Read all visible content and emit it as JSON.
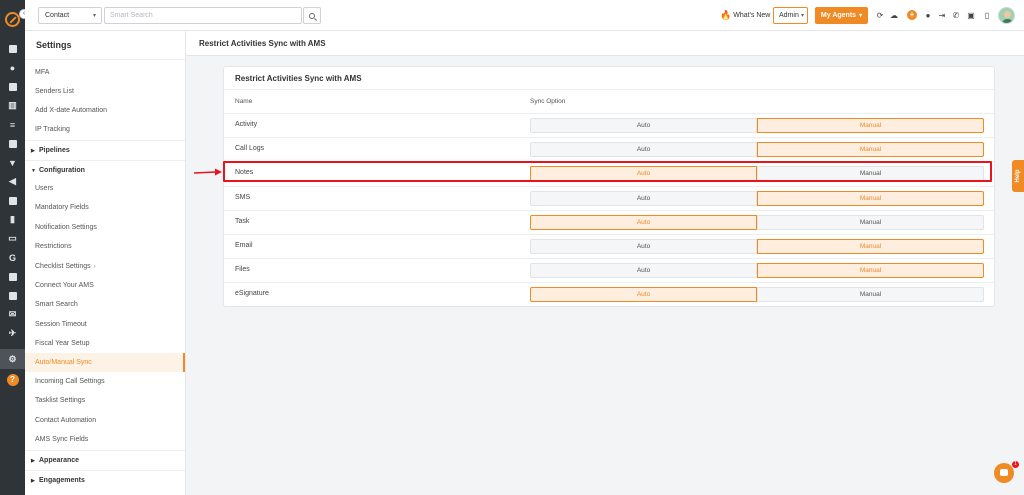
{
  "topbar": {
    "module_select": "Contact",
    "search_placeholder": "Smart Search",
    "whats_new": "What's New",
    "role_select": "Admin",
    "agents_button": "My Agents"
  },
  "settings": {
    "title": "Settings",
    "items": [
      {
        "label": "MFA",
        "type": "item"
      },
      {
        "label": "Senders List",
        "type": "item"
      },
      {
        "label": "Add X-date Automation",
        "type": "item"
      },
      {
        "label": "IP Tracking",
        "type": "item"
      },
      {
        "label": "Pipelines",
        "type": "section",
        "expanded": false
      },
      {
        "label": "Configuration",
        "type": "section",
        "expanded": true
      },
      {
        "label": "Users",
        "type": "item"
      },
      {
        "label": "Mandatory Fields",
        "type": "item"
      },
      {
        "label": "Notification Settings",
        "type": "item"
      },
      {
        "label": "Restrictions",
        "type": "item"
      },
      {
        "label": "Checklist Settings",
        "type": "item",
        "chevron": true
      },
      {
        "label": "Connect Your AMS",
        "type": "item"
      },
      {
        "label": "Smart Search",
        "type": "item"
      },
      {
        "label": "Session Timeout",
        "type": "item"
      },
      {
        "label": "Fiscal Year Setup",
        "type": "item"
      },
      {
        "label": "Auto/Manual Sync",
        "type": "item",
        "active": true
      },
      {
        "label": "Incoming Call Settings",
        "type": "item"
      },
      {
        "label": "Tasklist Settings",
        "type": "item"
      },
      {
        "label": "Contact Automation",
        "type": "item"
      },
      {
        "label": "AMS Sync Fields",
        "type": "item"
      },
      {
        "label": "Appearance",
        "type": "section",
        "expanded": false
      },
      {
        "label": "Engagements",
        "type": "section",
        "expanded": false
      }
    ]
  },
  "page": {
    "header_title": "Restrict Activities Sync with AMS",
    "card_title": "Restrict Activities Sync with AMS",
    "col_name": "Name",
    "col_sync": "Sync Option",
    "auto_label": "Auto",
    "manual_label": "Manual",
    "rows": [
      {
        "name": "Activity",
        "selected": "Manual"
      },
      {
        "name": "Call Logs",
        "selected": "Manual"
      },
      {
        "name": "Notes",
        "selected": "Auto"
      },
      {
        "name": "SMS",
        "selected": "Manual"
      },
      {
        "name": "Task",
        "selected": "Auto"
      },
      {
        "name": "Email",
        "selected": "Manual"
      },
      {
        "name": "Files",
        "selected": "Manual"
      },
      {
        "name": "eSignature",
        "selected": "Auto"
      }
    ]
  },
  "help_tab": "Help",
  "chat_badge": "1",
  "colors": {
    "accent": "#f08a24",
    "annotation": "#e8141a",
    "rail": "#2f3438"
  }
}
